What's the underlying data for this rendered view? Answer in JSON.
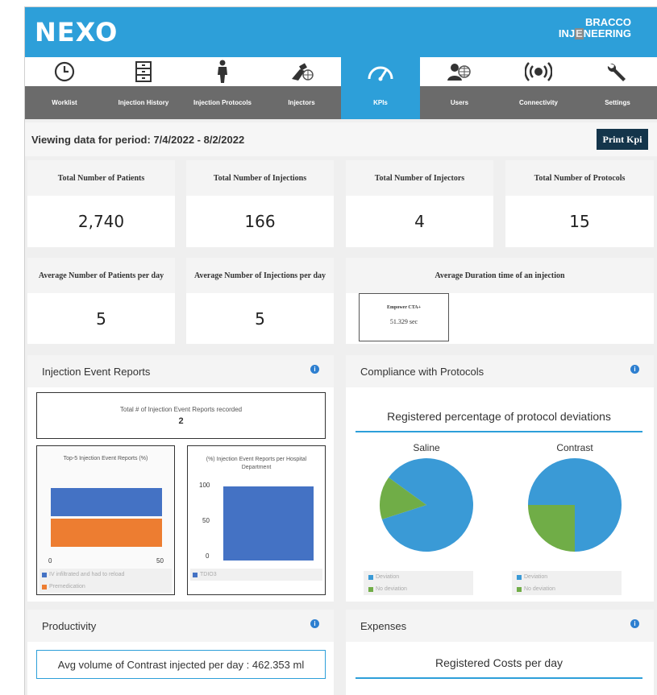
{
  "app": {
    "logo": "NEXO",
    "brand_line1": "BRACCO",
    "brand_line2_a": "INJ",
    "brand_line2_b": "E",
    "brand_line2_c": "NEERING"
  },
  "nav": [
    {
      "label": "Worklist",
      "icon": "clock-icon"
    },
    {
      "label": "Injection History",
      "icon": "cabinet-icon"
    },
    {
      "label": "Injection Protocols",
      "icon": "person-icon"
    },
    {
      "label": "Injectors",
      "icon": "injector-icon"
    },
    {
      "label": "KPIs",
      "icon": "gauge-icon",
      "active": true
    },
    {
      "label": "Users",
      "icon": "user-globe-icon"
    },
    {
      "label": "Connectivity",
      "icon": "broadcast-icon"
    },
    {
      "label": "Settings",
      "icon": "wrench-icon"
    }
  ],
  "period": {
    "text": "Viewing data for period: 7/4/2022 - 8/2/2022",
    "print_label": "Print Kpi"
  },
  "kpis": [
    {
      "label": "Total Number of Patients",
      "value": "2,740"
    },
    {
      "label": "Total Number of Injections",
      "value": "166"
    },
    {
      "label": "Total Number of Injectors",
      "value": "4"
    },
    {
      "label": "Total Number of Protocols",
      "value": "15"
    }
  ],
  "averages": [
    {
      "label": "Average Number of Patients per day",
      "value": "5"
    },
    {
      "label": "Average Number of Injections per day",
      "value": "5"
    }
  ],
  "duration": {
    "label": "Average Duration time of an injection",
    "injector": "Empower CTA+",
    "value": "51.329 sec"
  },
  "injection_reports": {
    "title": "Injection Event Reports",
    "total_label": "Total # of Injection Event Reports recorded",
    "total_value": "2",
    "top5": {
      "title": "Top-5 Injection Event Reports (%)",
      "axis_min": "0",
      "axis_max": "50",
      "legend": [
        "IV infiltrated and had to reload",
        "Premedication"
      ]
    },
    "per_dept": {
      "title": "(%) Injection Event Reports per Hospital Department",
      "ticks": [
        "100",
        "50",
        "0"
      ],
      "legend": [
        "TDIO3"
      ]
    }
  },
  "compliance": {
    "title": "Compliance with Protocols",
    "subtitle": "Registered percentage of protocol deviations",
    "saline": "Saline",
    "contrast": "Contrast",
    "legend_deviation": "Deviation",
    "legend_no_deviation": "No deviation"
  },
  "productivity": {
    "title": "Productivity",
    "avg_text": "Avg volume of Contrast injected per day : 462.353 ml"
  },
  "expenses": {
    "title": "Expenses",
    "subtitle": "Registered Costs per day"
  },
  "chart_data": [
    {
      "type": "bar",
      "title": "Top-5 Injection Event Reports (%)",
      "orientation": "horizontal",
      "series": [
        {
          "name": "IV infiltrated and had to reload",
          "values": [
            50
          ]
        },
        {
          "name": "Premedication",
          "values": [
            50
          ]
        }
      ],
      "xlim": [
        0,
        50
      ]
    },
    {
      "type": "bar",
      "title": "(%) Injection Event Reports per Hospital Department",
      "categories": [
        "TDIO3"
      ],
      "values": [
        100
      ],
      "ylim": [
        0,
        100
      ]
    },
    {
      "type": "pie",
      "title": "Saline",
      "labels": [
        "Deviation",
        "No deviation"
      ],
      "values": [
        85,
        15
      ]
    },
    {
      "type": "pie",
      "title": "Contrast",
      "labels": [
        "Deviation",
        "No deviation"
      ],
      "values": [
        75,
        25
      ]
    }
  ],
  "colors": {
    "accent": "#2d9fd9",
    "nav_gray": "#6b6b6b",
    "print": "#14354b",
    "bar_blue": "#4472c4",
    "bar_orange": "#ed7d31",
    "pie_blue": "#3a9ad6",
    "pie_green": "#70ad47"
  }
}
